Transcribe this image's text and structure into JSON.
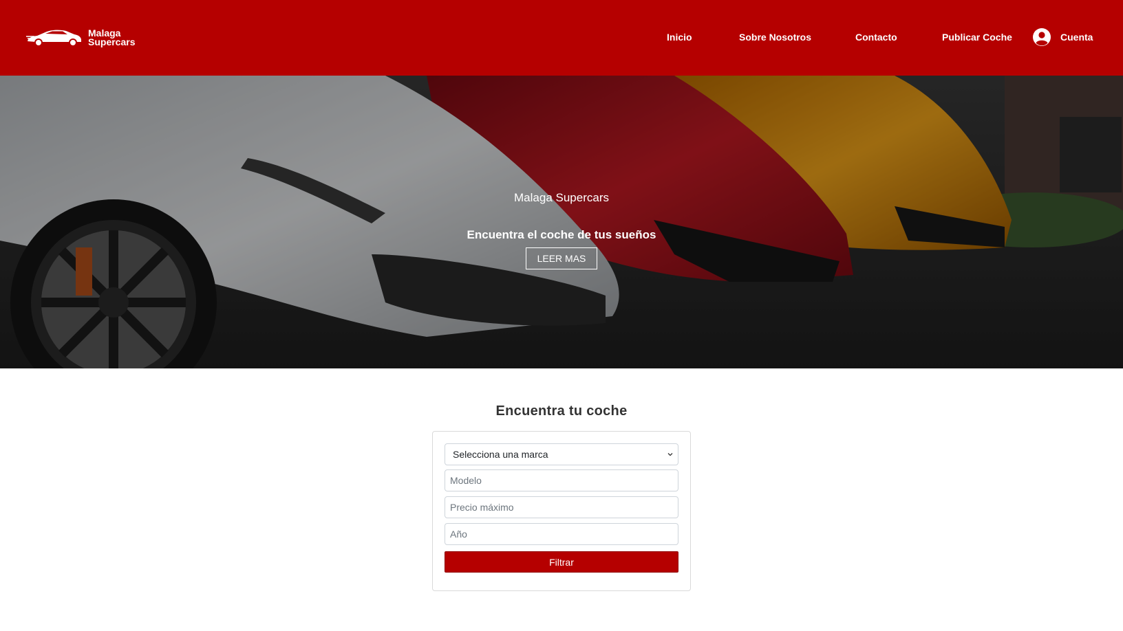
{
  "header": {
    "logo_line1": "Malaga",
    "logo_line2": "Supercars",
    "nav": {
      "inicio": "Inicio",
      "sobre": "Sobre Nosotros",
      "contacto": "Contacto",
      "publicar": "Publicar Coche",
      "cuenta": "Cuenta"
    }
  },
  "hero": {
    "subtitle": "Malaga Supercars",
    "title": "Encuentra el coche de tus sueños",
    "button": "LEER MAS"
  },
  "search": {
    "title": "Encuentra tu coche",
    "brand_select": "Selecciona una marca",
    "model_placeholder": "Modelo",
    "price_placeholder": "Precio máximo",
    "year_placeholder": "Año",
    "filter_button": "Filtrar"
  },
  "colors": {
    "brand_red": "#b50000"
  }
}
